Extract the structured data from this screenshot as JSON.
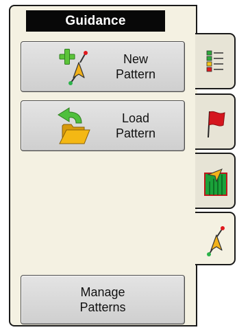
{
  "title": "Guidance",
  "buttons": {
    "new_pattern": {
      "line1": "New",
      "line2": "Pattern",
      "icon": "new-pattern-icon"
    },
    "load_pattern": {
      "line1": "Load",
      "line2": "Pattern",
      "icon": "load-pattern-icon"
    },
    "manage_patterns": {
      "line1": "Manage",
      "line2": "Patterns"
    }
  },
  "tabs": [
    {
      "icon": "list-icon",
      "active": false
    },
    {
      "icon": "flag-icon",
      "active": false
    },
    {
      "icon": "coverage-map-icon",
      "active": false
    },
    {
      "icon": "guidance-icon",
      "active": true
    }
  ],
  "colors": {
    "panel_background": "#f4f1e2",
    "title_bar": "#080808",
    "title_text": "#ffffff",
    "flag_red": "#d5161e",
    "coverage_green": "#1aa23a",
    "arrow_yellow": "#f2b21a",
    "folder_yellow": "#f4b814",
    "plus_green": "#5cc43a"
  }
}
